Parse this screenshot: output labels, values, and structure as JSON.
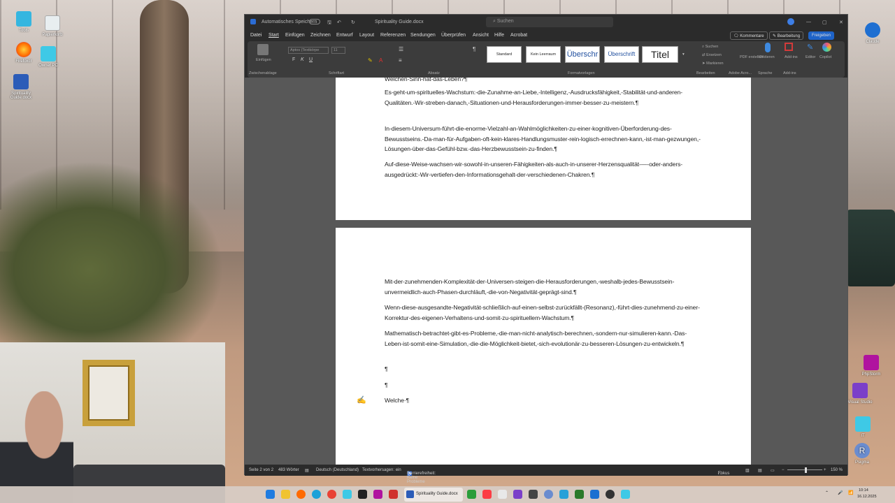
{
  "desktop": {
    "icons_left": [
      {
        "label": "Tools"
      },
      {
        "label": "Papierkorb"
      },
      {
        "label": "Firefoxcr"
      },
      {
        "label": "Owner PC"
      },
      {
        "label": "Spirituality Guide.docx"
      }
    ],
    "icons_right": [
      {
        "label": "Claude"
      },
      {
        "label": "PhpStorm"
      },
      {
        "label": "Visual Studio"
      },
      {
        "label": "IT"
      },
      {
        "label": "Psigma"
      }
    ]
  },
  "window": {
    "autosave_label": "Automatisches Speichern",
    "doc_title": "Spirituality Guide.docx",
    "search_placeholder": "Suchen",
    "menu": [
      "Datei",
      "Start",
      "Einfügen",
      "Zeichnen",
      "Entwurf",
      "Layout",
      "Referenzen",
      "Sendungen",
      "Überprüfen",
      "Ansicht",
      "Hilfe",
      "Acrobat"
    ],
    "active_menu": "Start",
    "btn_comments": "Kommentare",
    "btn_edit": "Bearbeitung",
    "btn_share": "Freigeben"
  },
  "ribbon": {
    "paste": "Einfügen",
    "font_name": "Aptos (Textkörpe",
    "font_size": "11",
    "styles": [
      "Standard",
      "Kein Leerraum",
      "Überschr",
      "Überschrift",
      "Titel"
    ],
    "find": "Suchen",
    "replace": "Ersetzen",
    "select": "Markieren",
    "pdf": "PDF erstellen",
    "dictate": "Diktieren",
    "addins": "Add-ins",
    "editor": "Editor",
    "copilot": "Copilot",
    "groups": [
      "Zwischenablage",
      "Schriftart",
      "Absatz",
      "Formatvorlagen",
      "Bearbeiten",
      "Adobe Acro...",
      "Sprache",
      "Add-ins"
    ]
  },
  "page1": [
    "Welchen-Sinn-hat-das-Leben?¶",
    "Es-geht-um-spirituelles-Wachstum:-die-Zunahme-an-Liebe,-Intelligenz,-Ausdrucksfähigkeit,-Stabilität-und-anderen-Qualitäten.-Wir-streben-danach,-Situationen-und-Herausforderungen-immer-besser-zu-meistern.¶",
    "In-diesem-Universum-führt-die-enorme-Vielzahl-an-Wahlmöglichkeiten-zu-einer-kognitiven-Überforderung-des-Bewusstseins.-Da-man-für-Aufgaben-oft-kein-klares-Handlungsmuster-rein-logisch-errechnen-kann,-ist-man-gezwungen,-Lösungen-über-das-Gefühl-bzw.-das-Herzbewusstsein-zu-finden.¶",
    "Auf-diese-Weise-wachsen-wir-sowohl-in-unseren-Fähigkeiten-als-auch-in-unserer-Herzensqualität-—-oder-anders-ausgedrückt:-Wir-vertiefen-den-Informationsgehalt-der-verschiedenen-Chakren.¶"
  ],
  "page2": [
    "Mit-der-zunehmenden-Komplexität-der-Universen-steigen-die-Herausforderungen,-weshalb-jedes-Bewusstsein-unvermeidlich-auch-Phasen-durchläuft,-die-von-Negativität-geprägt-sind.¶",
    "Wenn-diese-ausgesandte-Negativität-schließlich-auf-einen-selbst-zurückfällt-(Resonanz),-führt-dies-zunehmend-zu-einer-Korrektur-des-eigenen-Verhaltens-und-somit-zu-spirituellem-Wachstum.¶",
    "Mathematisch-betrachtet-gibt-es-Probleme,-die-man-nicht-analytisch-berechnen,-sondern-nur-simulieren-kann.-Das-Leben-ist-somit-eine-Simulation,-die-die-Möglichkeit-bietet,-sich-evolutionär-zu-besseren-Lösungen-zu-entwickeln.¶",
    "¶",
    "¶",
    "Welche·¶"
  ],
  "status": {
    "page": "Seite 2 von 2",
    "words": "483 Wörter",
    "language": "Deutsch (Deutschland)",
    "prediction": "Textvorhersagen: ein",
    "accessibility": "Barrierefreiheit: Keine Probleme",
    "focus": "Fokus",
    "zoom": "150 %"
  },
  "taskbar": {
    "active_app": "Spirituality Guide.docx",
    "time": "10:14",
    "date": "16.12.2025"
  }
}
